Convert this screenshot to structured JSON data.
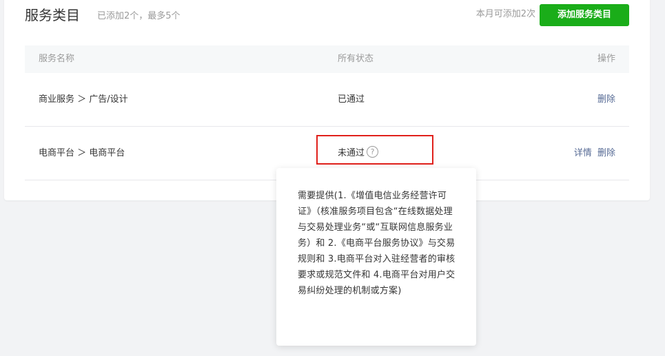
{
  "header": {
    "title": "服务类目",
    "subtitle": "已添加2个，最多5个",
    "quota": "本月可添加2次",
    "add_button": "添加服务类目"
  },
  "table": {
    "columns": [
      "服务名称",
      "所有状态",
      "操作"
    ],
    "rows": [
      {
        "name": "商业服务 ＞ 广告/设计",
        "status": "已通过",
        "actions": [
          "删除"
        ]
      },
      {
        "name": "电商平台 ＞ 电商平台",
        "status": "未通过",
        "actions": [
          "详情",
          "删除"
        ]
      }
    ]
  },
  "help_icon_glyph": "?",
  "tooltip": {
    "text": "需要提供(1.《增值电信业务经营许可证》（核准服务项目包含“在线数据处理与交易处理业务“或“互联网信息服务业务）和 2.《电商平台服务协议》与交易规则和 3.电商平台对入驻经营者的审核要求或规范文件和 4.电商平台对用户交易纠纷处理的机制或方案)"
  },
  "colors": {
    "primary_button": "#1aad19",
    "link": "#576b95",
    "highlight": "#e0201b",
    "muted_text": "#9a9a9a"
  }
}
